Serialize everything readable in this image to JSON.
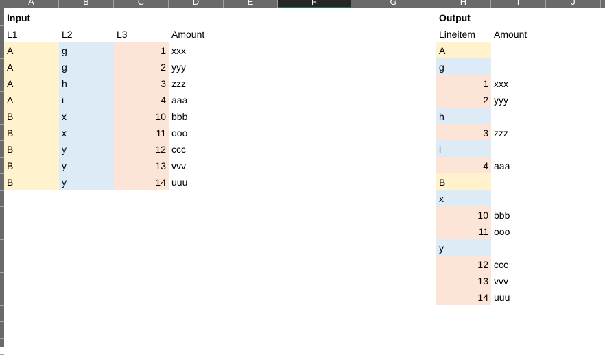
{
  "columns": [
    "A",
    "B",
    "C",
    "D",
    "E",
    "F",
    "G",
    "H",
    "I",
    "J"
  ],
  "selected_column": "F",
  "input": {
    "title": "Input",
    "headers": [
      "L1",
      "L2",
      "L3",
      "Amount"
    ],
    "rows": [
      [
        "A",
        "g",
        "1",
        "xxx"
      ],
      [
        "A",
        "g",
        "2",
        "yyy"
      ],
      [
        "A",
        "h",
        "3",
        "zzz"
      ],
      [
        "A",
        "i",
        "4",
        "aaa"
      ],
      [
        "B",
        "x",
        "10",
        "bbb"
      ],
      [
        "B",
        "x",
        "11",
        "ooo"
      ],
      [
        "B",
        "y",
        "12",
        "ccc"
      ],
      [
        "B",
        "y",
        "13",
        "vvv"
      ],
      [
        "B",
        "y",
        "14",
        "uuu"
      ]
    ]
  },
  "output": {
    "title": "Output",
    "headers": [
      "Lineitem",
      "Amount"
    ],
    "rows": [
      {
        "level": 1,
        "item": "A",
        "amount": ""
      },
      {
        "level": 2,
        "item": "g",
        "amount": ""
      },
      {
        "level": 3,
        "item": "1",
        "amount": "xxx"
      },
      {
        "level": 3,
        "item": "2",
        "amount": "yyy"
      },
      {
        "level": 2,
        "item": "h",
        "amount": ""
      },
      {
        "level": 3,
        "item": "3",
        "amount": "zzz"
      },
      {
        "level": 2,
        "item": "i",
        "amount": ""
      },
      {
        "level": 3,
        "item": "4",
        "amount": "aaa"
      },
      {
        "level": 1,
        "item": "B",
        "amount": ""
      },
      {
        "level": 2,
        "item": "x",
        "amount": ""
      },
      {
        "level": 3,
        "item": "10",
        "amount": "bbb"
      },
      {
        "level": 3,
        "item": "11",
        "amount": "ooo"
      },
      {
        "level": 2,
        "item": "y",
        "amount": ""
      },
      {
        "level": 3,
        "item": "12",
        "amount": "ccc"
      },
      {
        "level": 3,
        "item": "13",
        "amount": "vvv"
      },
      {
        "level": 3,
        "item": "14",
        "amount": "uuu"
      }
    ]
  },
  "colors": {
    "level1": "#fff2cc",
    "level2": "#ddebf7",
    "level3": "#fce4d6"
  }
}
